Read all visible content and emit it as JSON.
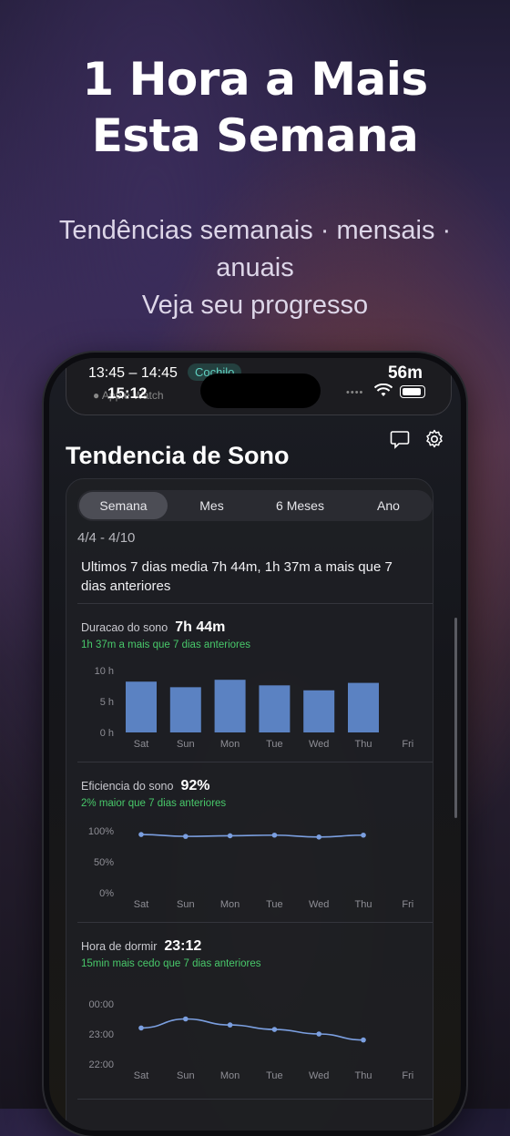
{
  "headline": {
    "line1": "1 Hora a Mais",
    "line2": "Esta Semana"
  },
  "subline": {
    "line1": "Tendências semanais · mensais ·",
    "line2": "anuais",
    "line3": "Veja seu progresso"
  },
  "status": {
    "range": "13:45 – 14:45",
    "badge": "Cochilo",
    "duration": "56m",
    "clock": "15:12",
    "device": "Apple Watch"
  },
  "app": {
    "title": "Tendencia de Sono",
    "icons": [
      "chat-icon",
      "gear-icon"
    ],
    "tabs": [
      "Semana",
      "Mes",
      "6 Meses",
      "Ano"
    ],
    "active_tab": "Semana",
    "date_range": "4/4 - 4/10",
    "summary": "Ultimos 7 dias media 7h 44m, 1h 37m a mais que 7 dias anteriores"
  },
  "sections": {
    "duration": {
      "label": "Duracao do sono",
      "value": "7h 44m",
      "note": "1h 37m a mais que 7 dias anteriores"
    },
    "efficiency": {
      "label": "Eficiencia do sono",
      "value": "92%",
      "note": "2% maior que 7 dias anteriores"
    },
    "bedtime": {
      "label": "Hora de dormir",
      "value": "23:12",
      "note": "15min mais cedo que 7 dias anteriores"
    }
  },
  "colors": {
    "bar": "#5b82c2",
    "line": "#7b9fe0",
    "positive": "#48c86a",
    "badge": "#5fd0c0"
  },
  "chart_data": [
    {
      "type": "bar",
      "categories": [
        "Sat",
        "Sun",
        "Mon",
        "Tue",
        "Wed",
        "Thu",
        "Fri"
      ],
      "values": [
        8.2,
        7.3,
        8.5,
        7.6,
        6.8,
        8.0,
        null
      ],
      "yticks": [
        "10 h",
        "5 h",
        "0 h"
      ],
      "ylim": [
        0,
        10
      ]
    },
    {
      "type": "line",
      "categories": [
        "Sat",
        "Sun",
        "Mon",
        "Tue",
        "Wed",
        "Thu",
        "Fri"
      ],
      "values": [
        94,
        91,
        92,
        93,
        90,
        93,
        null
      ],
      "yticks": [
        "100%",
        "50%",
        "0%"
      ],
      "ylim": [
        0,
        100
      ]
    },
    {
      "type": "line",
      "categories": [
        "Sat",
        "Sun",
        "Mon",
        "Tue",
        "Wed",
        "Thu",
        "Fri"
      ],
      "values": [
        23.2,
        23.5,
        23.3,
        23.15,
        23.0,
        22.8,
        null
      ],
      "yticks": [
        "00:00",
        "23:00",
        "22:00"
      ],
      "ylim": [
        22,
        24
      ]
    }
  ]
}
